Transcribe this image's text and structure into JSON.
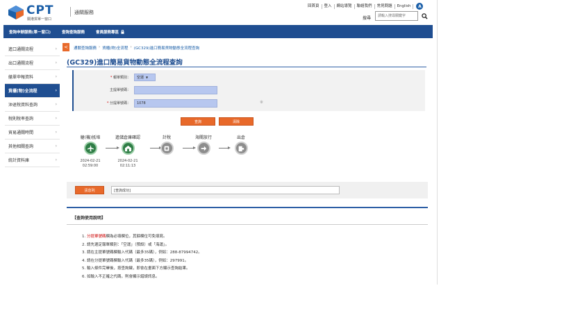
{
  "header": {
    "logo_text": "CPT",
    "logo_sub": "關港貿單一窗口",
    "brand_name": "通關服務",
    "top_links": [
      "回首頁",
      "登入",
      "網站導覽",
      "聯絡我們",
      "常見問題",
      "English"
    ],
    "lang_badge": "A",
    "search_label": "搜尋",
    "search_placeholder": "請輸入搜尋關鍵字"
  },
  "nav": {
    "items": [
      "查詢申辦服務(單一窗口)",
      "查詢查詢服務",
      "會員服務專區"
    ]
  },
  "sidebar": {
    "items": [
      {
        "label": "進口通關流程"
      },
      {
        "label": "出口通關流程"
      },
      {
        "label": "艙單申報資料"
      },
      {
        "label": "貨櫃(物)全流程"
      },
      {
        "label": "沖退稅資料查詢"
      },
      {
        "label": "稅則稅率查詢"
      },
      {
        "label": "貿易通關時間"
      },
      {
        "label": "其他相關查詢"
      },
      {
        "label": "統計資料庫"
      }
    ]
  },
  "breadcrumb": {
    "back_label": "<",
    "items": [
      "通關查詢服務",
      "貨櫃(物)全流程",
      "(GC329)進口簡易貨物動態全流程查詢"
    ]
  },
  "page": {
    "title": "(GC329)進口簡易貨物動態全流程查詢"
  },
  "form": {
    "type_label": "報單類別：",
    "type_value": "空運",
    "master_label": "主提單號碼：",
    "master_value": "",
    "house_label": "分提單號碼：",
    "house_value": "1078",
    "star": "※",
    "query_label": "查詢",
    "clear_label": "清除"
  },
  "process": {
    "steps": [
      {
        "label": "艙(機)抵埠",
        "date": "2024-02-21",
        "time": "02:59:00",
        "status": "done",
        "icon": "airplane-icon"
      },
      {
        "label": "進儲倉庫確認",
        "date": "2024-02-21",
        "time": "02:11:13",
        "status": "done",
        "icon": "warehouse-icon"
      },
      {
        "label": "計稅",
        "date": "",
        "time": "",
        "status": "todo",
        "icon": "tax-icon"
      },
      {
        "label": "海關放行",
        "date": "",
        "time": "",
        "status": "todo",
        "icon": "arrow-right-icon"
      },
      {
        "label": "出倉",
        "date": "",
        "time": "",
        "status": "todo",
        "icon": "exit-icon"
      }
    ]
  },
  "message": {
    "button_label": "訊息列",
    "field_value": "[查詢成功]"
  },
  "instructions": {
    "title": "【查詢使用說明】",
    "lines": [
      {
        "num": "1.",
        "red": "分提單號碼",
        "text": "欄為必填欄位，其餘欄位可免填寫。"
      },
      {
        "num": "2.",
        "red": "",
        "text": "請先選定報單類別：「空運」（預設）或「海運」。"
      },
      {
        "num": "3.",
        "red": "",
        "text": "請在主提單號碼欄輸入代碼（最多35碼），例如：288-87994742。"
      },
      {
        "num": "4.",
        "red": "",
        "text": "請在分提單號碼欄輸入代碼（最多35碼），例如：297991。"
      },
      {
        "num": "5.",
        "red": "",
        "text": "輸入條件完畢後，按查詢鍵，即會在畫面下方顯示查詢結果。"
      },
      {
        "num": "6.",
        "red": "",
        "text": "如輸入不正確之代碼，則會顯示錯誤訊息。"
      }
    ]
  },
  "colors": {
    "primary": "#1f4e91",
    "accent": "#e8692a",
    "field": "#b7c7ef",
    "done": "#2f7d46",
    "todo": "#8d8d8d"
  }
}
